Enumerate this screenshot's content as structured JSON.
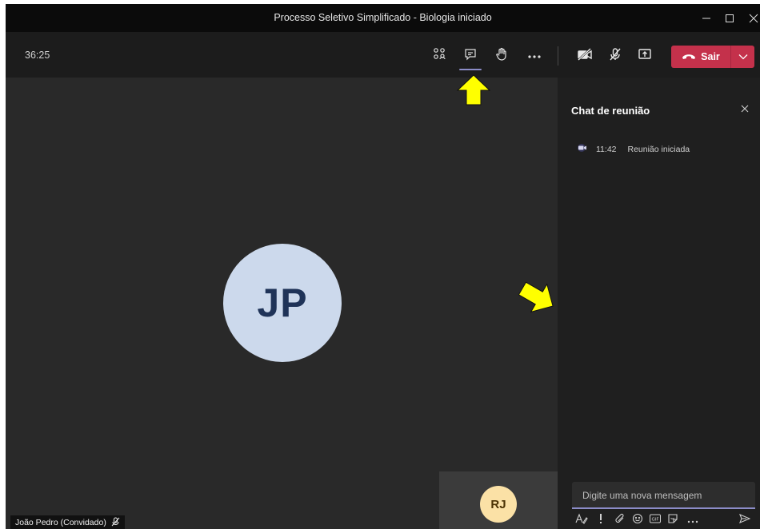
{
  "window": {
    "title": "Processo Seletivo Simplificado - Biologia iniciado"
  },
  "toolbar": {
    "timer": "36:25",
    "leave_label": "Sair"
  },
  "stage": {
    "main_initials": "JP",
    "thumb_initials": "RJ",
    "participant_name": "João Pedro (Convidado)"
  },
  "chat": {
    "title": "Chat de reunião",
    "event_time": "11:42",
    "event_text": "Reunião iniciada",
    "compose_placeholder": "Digite uma nova mensagem"
  },
  "colors": {
    "leave_button": "#c4314b",
    "accent": "#8b8cc7",
    "annotation_arrow": "#ffff00"
  },
  "icons": {
    "toolbar": [
      "participants-icon",
      "chat-icon",
      "raise-hand-icon",
      "more-icon",
      "camera-off-icon",
      "mic-off-icon",
      "share-screen-icon",
      "phone-icon",
      "chevron-down-icon"
    ],
    "compose": [
      "format-icon",
      "important-icon",
      "attach-icon",
      "emoji-icon",
      "gif-icon",
      "sticker-icon",
      "more-icon",
      "send-icon"
    ]
  }
}
